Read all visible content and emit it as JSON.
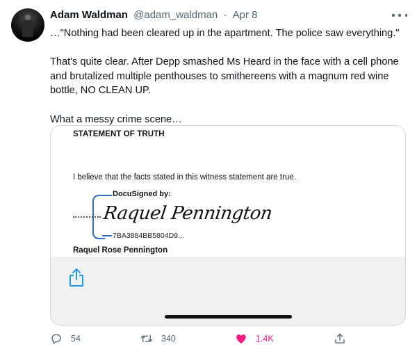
{
  "tweet": {
    "author_name": "Adam Waldman",
    "handle": "@adam_waldman",
    "date": "Apr 8",
    "separator": "·",
    "text": [
      "…\"Nothing had been cleared up in the apartment. The police saw everything.\"",
      "That's quite clear. After Depp smashed Ms Heard in the face with a cell phone and brutalized multiple penthouses to smithereens with a magnum red wine bottle, NO CLEAN UP.",
      "What a messy crime scene…"
    ]
  },
  "document": {
    "title": "STATEMENT OF TRUTH",
    "statement": "I believe that the facts stated in this witness statement are true.",
    "docusign_label": "DocuSigned by:",
    "signature": "Raquel Pennington",
    "docusign_id": "7BA3884BB5804D9...",
    "signer_name": "Raquel Rose Pennington"
  },
  "actions": {
    "replies": "54",
    "retweets": "340",
    "likes": "1.4K"
  },
  "colors": {
    "like_active": "#f91880",
    "muted": "#536471",
    "link_blue": "#1d9bf0",
    "docusign_blue": "#2d6bd6"
  },
  "icons": {
    "reply": "reply-icon",
    "retweet": "retweet-icon",
    "like": "heart-icon",
    "share": "share-icon",
    "more": "more-icon",
    "ios_share": "ios-share-icon"
  }
}
